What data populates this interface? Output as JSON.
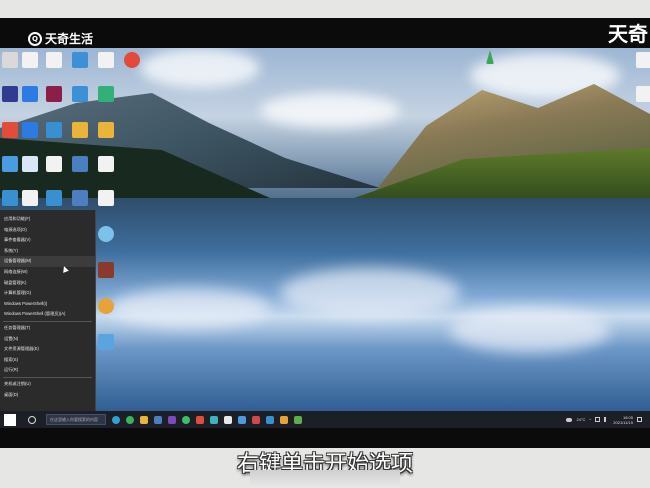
{
  "watermark": {
    "logo_text": "天奇生活",
    "logo_mark": "Q",
    "corner_text": "天奇"
  },
  "context_menu": {
    "items": [
      "应用和功能(F)",
      "电源选项(O)",
      "事件查看器(V)",
      "系统(Y)",
      "设备管理器(M)",
      "网络连接(W)",
      "磁盘管理(K)",
      "计算机管理(G)",
      "Windows PowerShell(I)",
      "Windows PowerShell (管理员)(A)",
      "任务管理器(T)",
      "设置(N)",
      "文件资源管理器(E)",
      "搜索(S)",
      "运行(R)",
      "关机或注销(U)",
      "桌面(D)"
    ],
    "hover_index": 4
  },
  "taskbar": {
    "search_placeholder": "在这里输入你要搜索的内容",
    "weather": "24°C",
    "time": "18:05",
    "date": "2021/11/15"
  },
  "subtitle": "右键单击开始选项",
  "colors": {
    "menu_bg": "#2b2b2b",
    "taskbar_bg": "#1c1f26",
    "accent": "#0078d4"
  }
}
